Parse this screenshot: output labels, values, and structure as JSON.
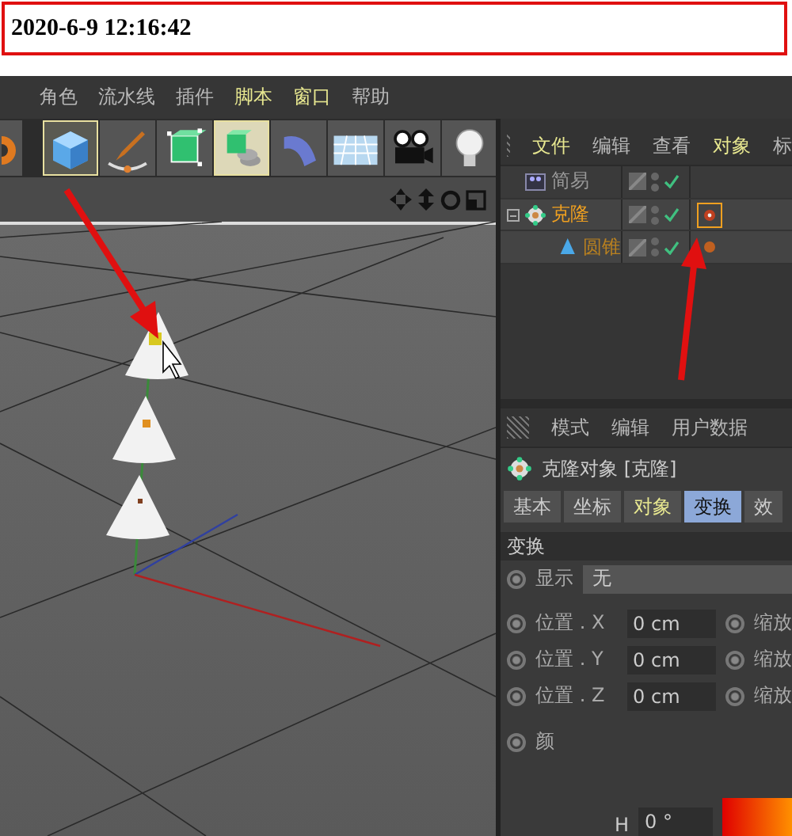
{
  "timestamp": "2020-6-9 12:16:42",
  "main_menu": [
    {
      "label": "角色",
      "highlight": false
    },
    {
      "label": "流水线",
      "highlight": false
    },
    {
      "label": "插件",
      "highlight": false
    },
    {
      "label": "脚本",
      "highlight": true
    },
    {
      "label": "窗口",
      "highlight": true
    },
    {
      "label": "帮助",
      "highlight": false
    }
  ],
  "toolbar": [
    {
      "kind": "gear",
      "selected": false
    },
    {
      "kind": "cube",
      "selected": true
    },
    {
      "kind": "pen",
      "selected": false
    },
    {
      "kind": "generator",
      "selected": false
    },
    {
      "kind": "array",
      "selected": true
    },
    {
      "kind": "deformer",
      "selected": false
    },
    {
      "kind": "floor",
      "selected": false
    },
    {
      "kind": "camera",
      "selected": false
    },
    {
      "kind": "light",
      "selected": false
    }
  ],
  "object_manager": {
    "menu": [
      {
        "label": "文件",
        "highlight": true
      },
      {
        "label": "编辑",
        "highlight": false
      },
      {
        "label": "查看",
        "highlight": false
      },
      {
        "label": "对象",
        "highlight": true
      },
      {
        "label": "标",
        "highlight": false
      }
    ],
    "objects": [
      {
        "name": "简易",
        "kind": "display",
        "selected": false
      },
      {
        "name": "克隆",
        "kind": "cloner",
        "selected": true,
        "expanded": true,
        "tag": {
          "kind": "cloner",
          "selected": true
        },
        "children": [
          {
            "name": "圆锥",
            "kind": "cone",
            "selected": true,
            "tag": {
              "kind": "dot",
              "selected": false
            }
          }
        ]
      }
    ]
  },
  "attribute_manager": {
    "menu": [
      "模式",
      "编辑",
      "用户数据"
    ],
    "title": "克隆对象 [克隆]",
    "tabs": [
      {
        "label": "基本",
        "selected": false,
        "highlight": false
      },
      {
        "label": "坐标",
        "selected": false,
        "highlight": false
      },
      {
        "label": "对象",
        "selected": false,
        "highlight": true
      },
      {
        "label": "变换",
        "selected": true,
        "highlight": false
      },
      {
        "label": "效",
        "selected": false
      }
    ],
    "section": "变换",
    "display": {
      "label": "显示",
      "value": "无"
    },
    "rows": [
      {
        "label": "位置 . X",
        "value": "0 cm",
        "right_label": "缩放"
      },
      {
        "label": "位置 . Y",
        "value": "0 cm",
        "right_label": "缩放"
      },
      {
        "label": "位置 . Z",
        "value": "0 cm",
        "right_label": "缩放"
      }
    ],
    "color_label": "颜",
    "hue": {
      "label": "H",
      "value": "0 °"
    }
  }
}
